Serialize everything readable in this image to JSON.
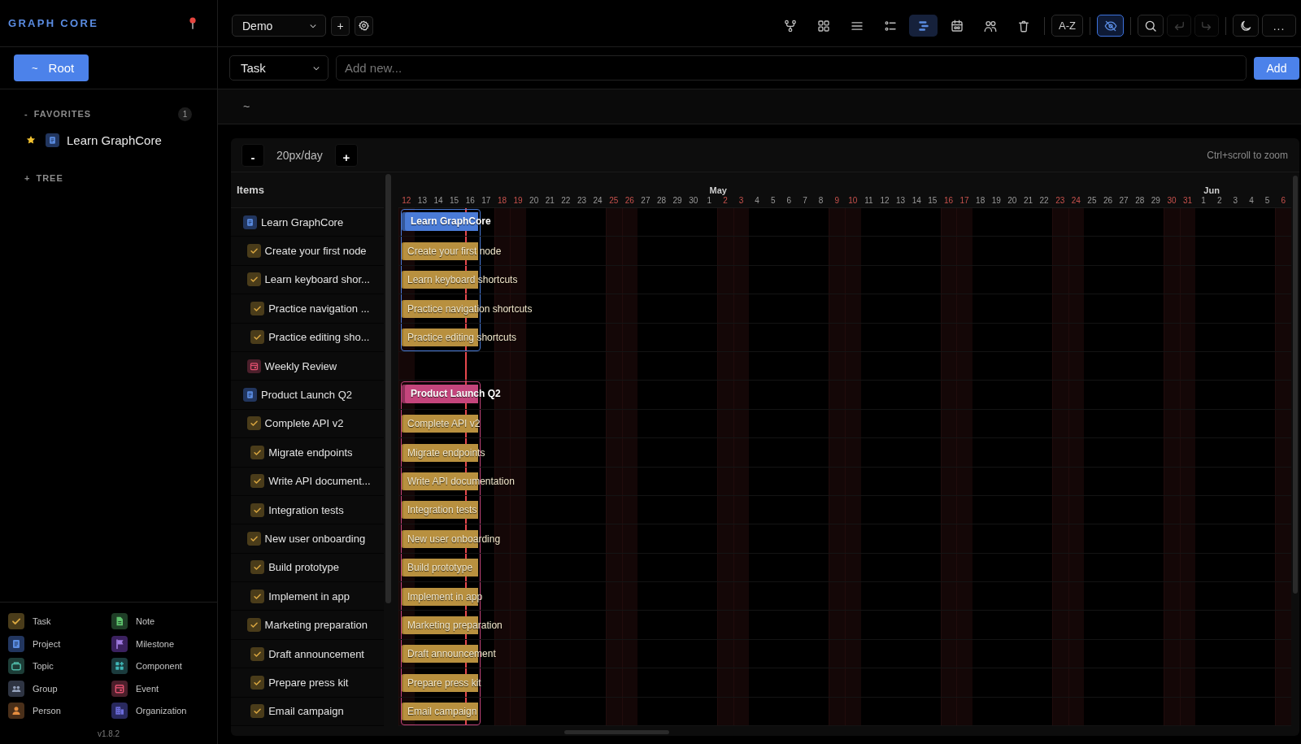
{
  "sidebar": {
    "logo": "GRAPH CORE",
    "root_button": {
      "symbol": "~",
      "label": "Root"
    },
    "sections": [
      {
        "toggle": "-",
        "title": "FAVORITES",
        "count": "1",
        "items": [
          {
            "kind": "project",
            "label": "Learn GraphCore",
            "starred": true
          }
        ]
      },
      {
        "toggle": "+",
        "title": "TREE"
      }
    ],
    "legend": [
      {
        "kind": "task",
        "label": "Task"
      },
      {
        "kind": "note",
        "label": "Note"
      },
      {
        "kind": "project",
        "label": "Project"
      },
      {
        "kind": "milestone",
        "label": "Milestone"
      },
      {
        "kind": "topic",
        "label": "Topic"
      },
      {
        "kind": "component",
        "label": "Component"
      },
      {
        "kind": "group",
        "label": "Group"
      },
      {
        "kind": "event",
        "label": "Event"
      },
      {
        "kind": "person",
        "label": "Person"
      },
      {
        "kind": "organization",
        "label": "Organization"
      }
    ],
    "version": "v1.8.2"
  },
  "topbar": {
    "workspace": "Demo",
    "workspace_actions": [
      {
        "kind": "add",
        "label": "+"
      },
      {
        "kind": "settings"
      }
    ],
    "views": [
      {
        "kind": "graph",
        "selected": false
      },
      {
        "kind": "grid",
        "selected": false
      },
      {
        "kind": "list",
        "selected": false
      },
      {
        "kind": "outline",
        "selected": false
      },
      {
        "kind": "gantt",
        "selected": true
      },
      {
        "kind": "calendar",
        "selected": false
      },
      {
        "kind": "people",
        "selected": false
      },
      {
        "kind": "trash",
        "selected": false
      }
    ],
    "sort": {
      "label": "A-Z"
    },
    "hide_toggle": {
      "on": true
    },
    "edit_tools": [
      {
        "kind": "search",
        "disabled": false
      },
      {
        "kind": "undo",
        "disabled": true
      },
      {
        "kind": "redo",
        "disabled": true
      }
    ],
    "actions": [
      {
        "kind": "theme"
      },
      {
        "kind": "more",
        "label": "..."
      }
    ]
  },
  "composer": {
    "type": "Task",
    "placeholder": "Add new...",
    "button": "Add"
  },
  "breadcrumb": [
    "~"
  ],
  "gantt": {
    "zoom_out": "-",
    "scale": "20px/day",
    "zoom_in": "+",
    "hint": "Ctrl+scroll to zoom",
    "items_heading": "Items",
    "days": [
      {
        "label": "12",
        "weekend": true,
        "today": false
      },
      {
        "label": "13",
        "weekend": false,
        "today": false
      },
      {
        "label": "14",
        "weekend": false,
        "today": false
      },
      {
        "label": "15",
        "weekend": false,
        "today": false
      },
      {
        "label": "16",
        "weekend": false,
        "today": true
      },
      {
        "label": "17",
        "weekend": false,
        "today": false
      },
      {
        "label": "18",
        "weekend": true,
        "today": false
      },
      {
        "label": "19",
        "weekend": true,
        "today": false
      },
      {
        "label": "20",
        "weekend": false,
        "today": false
      },
      {
        "label": "21",
        "weekend": false,
        "today": false
      },
      {
        "label": "22",
        "weekend": false,
        "today": false
      },
      {
        "label": "23",
        "weekend": false,
        "today": false
      },
      {
        "label": "24",
        "weekend": false,
        "today": false
      },
      {
        "label": "25",
        "weekend": true,
        "today": false
      },
      {
        "label": "26",
        "weekend": true,
        "today": false
      },
      {
        "label": "27",
        "weekend": false,
        "today": false
      },
      {
        "label": "28",
        "weekend": false,
        "today": false
      },
      {
        "label": "29",
        "weekend": false,
        "today": false
      },
      {
        "label": "30",
        "weekend": false,
        "today": false
      },
      {
        "label": "1",
        "weekend": false,
        "today": false,
        "month": "May"
      },
      {
        "label": "2",
        "weekend": true,
        "today": false
      },
      {
        "label": "3",
        "weekend": true,
        "today": false
      },
      {
        "label": "4",
        "weekend": false,
        "today": false
      },
      {
        "label": "5",
        "weekend": false,
        "today": false
      },
      {
        "label": "6",
        "weekend": false,
        "today": false
      },
      {
        "label": "7",
        "weekend": false,
        "today": false
      },
      {
        "label": "8",
        "weekend": false,
        "today": false
      },
      {
        "label": "9",
        "weekend": true,
        "today": false
      },
      {
        "label": "10",
        "weekend": true,
        "today": false
      },
      {
        "label": "11",
        "weekend": false,
        "today": false
      },
      {
        "label": "12",
        "weekend": false,
        "today": false
      },
      {
        "label": "13",
        "weekend": false,
        "today": false
      },
      {
        "label": "14",
        "weekend": false,
        "today": false
      },
      {
        "label": "15",
        "weekend": false,
        "today": false
      },
      {
        "label": "16",
        "weekend": true,
        "today": false
      },
      {
        "label": "17",
        "weekend": true,
        "today": false
      },
      {
        "label": "18",
        "weekend": false,
        "today": false
      },
      {
        "label": "19",
        "weekend": false,
        "today": false
      },
      {
        "label": "20",
        "weekend": false,
        "today": false
      },
      {
        "label": "21",
        "weekend": false,
        "today": false
      },
      {
        "label": "22",
        "weekend": false,
        "today": false
      },
      {
        "label": "23",
        "weekend": true,
        "today": false
      },
      {
        "label": "24",
        "weekend": true,
        "today": false
      },
      {
        "label": "25",
        "weekend": false,
        "today": false
      },
      {
        "label": "26",
        "weekend": false,
        "today": false
      },
      {
        "label": "27",
        "weekend": false,
        "today": false
      },
      {
        "label": "28",
        "weekend": false,
        "today": false
      },
      {
        "label": "29",
        "weekend": false,
        "today": false
      },
      {
        "label": "30",
        "weekend": true,
        "today": false
      },
      {
        "label": "31",
        "weekend": true,
        "today": false
      },
      {
        "label": "1",
        "weekend": false,
        "today": false,
        "month": "Jun"
      },
      {
        "label": "2",
        "weekend": false,
        "today": false
      },
      {
        "label": "3",
        "weekend": false,
        "today": false
      },
      {
        "label": "4",
        "weekend": false,
        "today": false
      },
      {
        "label": "5",
        "weekend": false,
        "today": false
      },
      {
        "label": "6",
        "weekend": true,
        "today": false
      }
    ],
    "items": [
      {
        "kind": "project",
        "label": "Learn GraphCore",
        "bar": {
          "label": "Learn GraphCore",
          "span": [
            true,
            true,
            true,
            true,
            true
          ],
          "color": "#4a7bd6"
        },
        "children": [
          {
            "kind": "task",
            "label": "Create your first node",
            "bar": {
              "label": "Create your first node",
              "span": [
                true,
                true,
                true,
                true,
                true
              ]
            }
          },
          {
            "kind": "task",
            "label": "Learn keyboard shor...",
            "bar": {
              "label": "Learn keyboard shortcuts",
              "span": [
                true,
                true,
                true,
                true,
                true
              ]
            },
            "children": [
              {
                "kind": "task",
                "label": "Practice navigation ...",
                "bar": {
                  "label": "Practice navigation shortcuts",
                  "span": [
                    true,
                    true,
                    true,
                    true,
                    true
                  ]
                }
              },
              {
                "kind": "task",
                "label": "Practice editing sho...",
                "bar": {
                  "label": "Practice editing shortcuts",
                  "span": [
                    true,
                    true,
                    true,
                    true,
                    true
                  ]
                }
              }
            ]
          },
          {
            "kind": "event",
            "label": "Weekly Review"
          }
        ]
      },
      {
        "kind": "project",
        "label": "Product Launch Q2",
        "bar": {
          "label": "Product Launch Q2",
          "span": [
            true,
            true,
            true,
            true,
            true
          ],
          "color": "#c4457c"
        },
        "children": [
          {
            "kind": "task",
            "label": "Complete API v2",
            "bar": {
              "label": "Complete API v2",
              "span": [
                true,
                true,
                true,
                true,
                true
              ]
            },
            "children": [
              {
                "kind": "task",
                "label": "Migrate endpoints",
                "bar": {
                  "label": "Migrate endpoints",
                  "span": [
                    true,
                    true,
                    true,
                    true,
                    true
                  ]
                }
              },
              {
                "kind": "task",
                "label": "Write API document...",
                "bar": {
                  "label": "Write API documentation",
                  "span": [
                    true,
                    true,
                    true,
                    true,
                    true
                  ]
                }
              },
              {
                "kind": "task",
                "label": "Integration tests",
                "bar": {
                  "label": "Integration tests",
                  "span": [
                    true,
                    true,
                    true,
                    true,
                    true
                  ]
                }
              }
            ]
          },
          {
            "kind": "task",
            "label": "New user onboarding",
            "bar": {
              "label": "New user onboarding",
              "span": [
                true,
                true,
                true,
                true,
                true
              ]
            },
            "children": [
              {
                "kind": "task",
                "label": "Build prototype",
                "bar": {
                  "label": "Build prototype",
                  "span": [
                    true,
                    true,
                    true,
                    true,
                    true
                  ]
                }
              },
              {
                "kind": "task",
                "label": "Implement in app",
                "bar": {
                  "label": "Implement in app",
                  "span": [
                    true,
                    true,
                    true,
                    true,
                    true
                  ]
                }
              }
            ]
          },
          {
            "kind": "task",
            "label": "Marketing preparation",
            "bar": {
              "label": "Marketing preparation",
              "span": [
                true,
                true,
                true,
                true,
                true
              ]
            },
            "children": [
              {
                "kind": "task",
                "label": "Draft announcement",
                "bar": {
                  "label": "Draft announcement",
                  "span": [
                    true,
                    true,
                    true,
                    true,
                    true
                  ]
                }
              },
              {
                "kind": "task",
                "label": "Prepare press kit",
                "bar": {
                  "label": "Prepare press kit",
                  "span": [
                    true,
                    true,
                    true,
                    true,
                    true
                  ]
                }
              },
              {
                "kind": "task",
                "label": "Email campaign",
                "bar": {
                  "label": "Email campaign",
                  "span": [
                    true,
                    true,
                    true,
                    true,
                    true
                  ]
                }
              }
            ]
          }
        ]
      }
    ]
  }
}
